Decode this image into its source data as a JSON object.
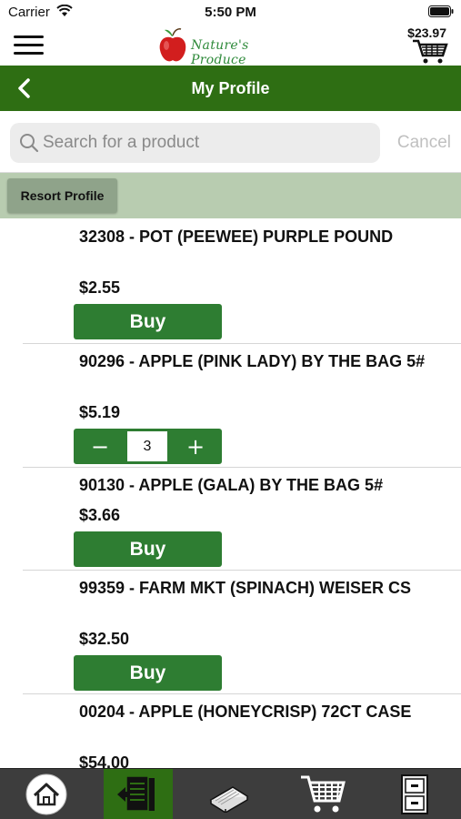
{
  "status_bar": {
    "carrier": "Carrier",
    "time": "5:50 PM"
  },
  "header": {
    "logo_text": "Nature's Produce",
    "cart_total": "$23.97"
  },
  "nav": {
    "title": "My Profile"
  },
  "search": {
    "placeholder": "Search for a product",
    "value": "",
    "cancel_label": "Cancel"
  },
  "resort": {
    "label": "Resort Profile"
  },
  "products": [
    {
      "name": "32308 - POT (PEEWEE) PURPLE POUND",
      "price": "$2.55",
      "action": "Buy"
    },
    {
      "name": "90296 - APPLE (PINK LADY) BY THE BAG 5#",
      "price": "$5.19",
      "quantity": "3",
      "minus": "−",
      "plus": "+"
    },
    {
      "name": "90130 - APPLE (GALA) BY THE BAG 5#",
      "price": "$3.66",
      "action": "Buy"
    },
    {
      "name": "99359 - FARM MKT (SPINACH) WEISER CS",
      "price": "$32.50",
      "action": "Buy"
    },
    {
      "name": "00204 - APPLE (HONEYCRISP) 72CT CASE",
      "price": "$54.00"
    }
  ],
  "tabs": [
    {
      "icon": "home-icon",
      "active": false
    },
    {
      "icon": "order-list-icon",
      "active": true
    },
    {
      "icon": "catalog-book-icon",
      "active": false
    },
    {
      "icon": "shopping-cart-icon",
      "active": false
    },
    {
      "icon": "file-cabinet-icon",
      "active": false
    }
  ],
  "colors": {
    "primary_green": "#2e6e13",
    "button_green": "#2e7d32",
    "resort_bar": "#b8ccb0",
    "tab_bar": "#3d3d3d"
  }
}
